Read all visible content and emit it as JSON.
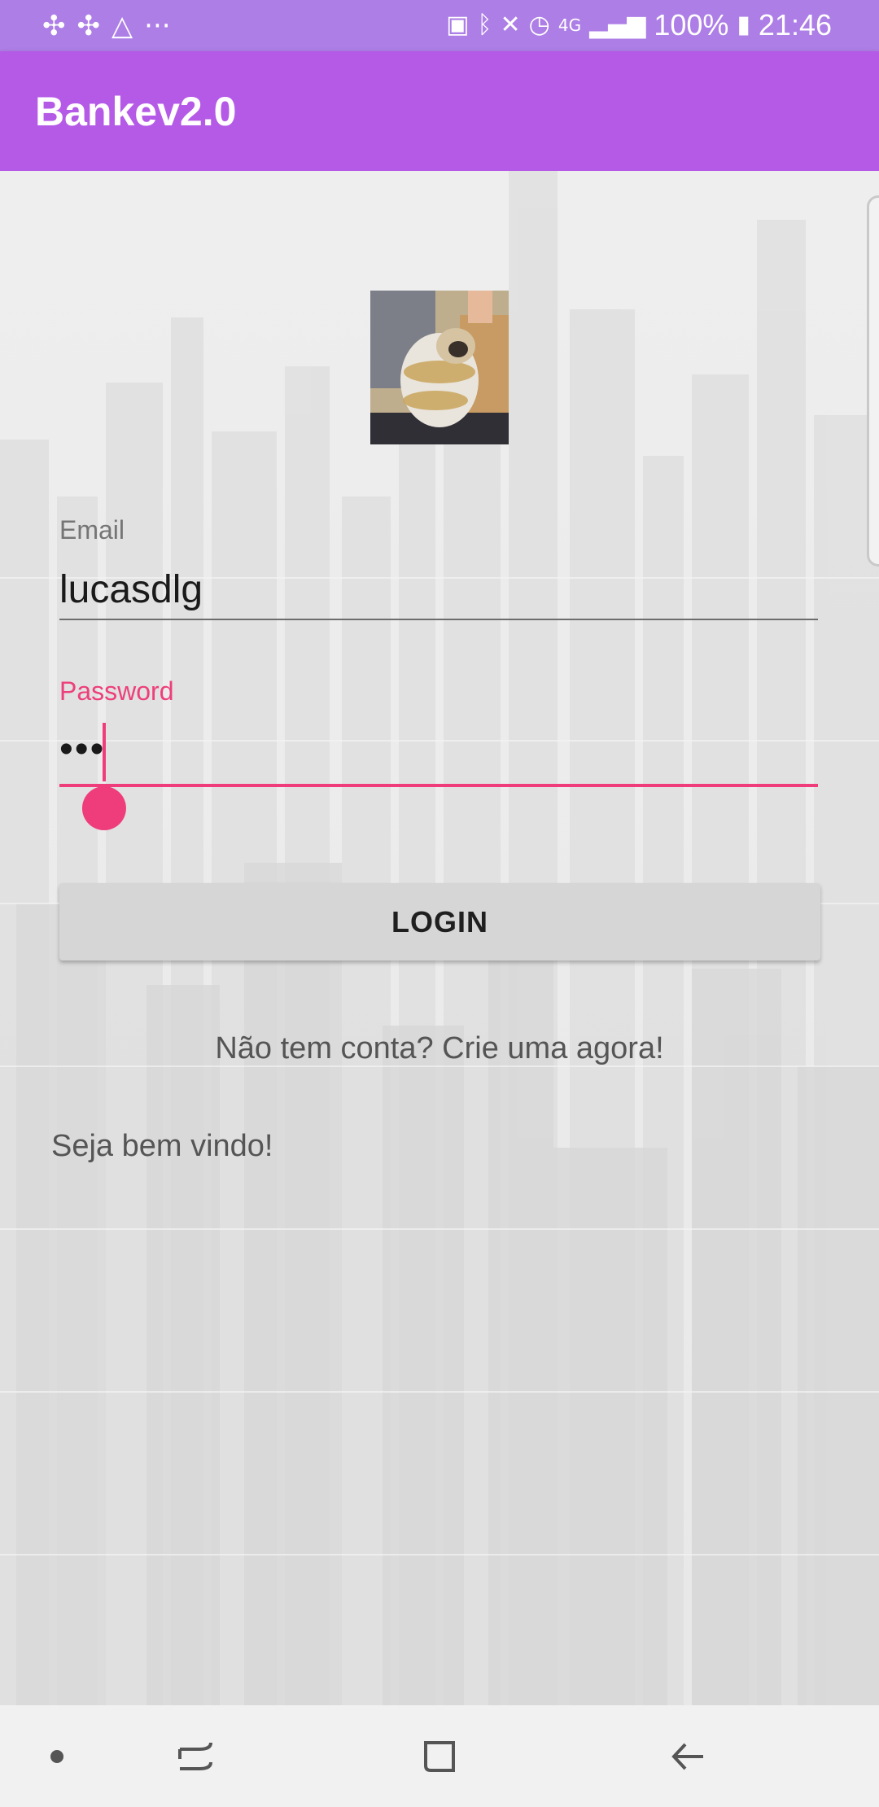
{
  "status_bar": {
    "left_icons": [
      "pinwheel-icon",
      "pinwheel-icon",
      "triangle-a-icon",
      "more-icon"
    ],
    "right_icons": [
      "sim-icon",
      "bluetooth-icon",
      "mute-icon",
      "alarm-icon",
      "4g-icon",
      "signal-icon"
    ],
    "battery_percent": "100%",
    "time": "21:46"
  },
  "app_bar": {
    "title": "Bankev2.0",
    "color": "#b55ae6"
  },
  "form": {
    "email_label": "Email",
    "email_value": "lucasdlg",
    "password_label": "Password",
    "password_value": "•••",
    "focus_color": "#ee3d7a"
  },
  "login_button": {
    "label": "LOGIN"
  },
  "signup_link": "Não tem conta? Crie uma agora!",
  "welcome_text": "Seja bem vindo!",
  "nav_bar": {
    "items": [
      "dot-icon",
      "recents-icon",
      "home-icon",
      "back-icon"
    ]
  }
}
